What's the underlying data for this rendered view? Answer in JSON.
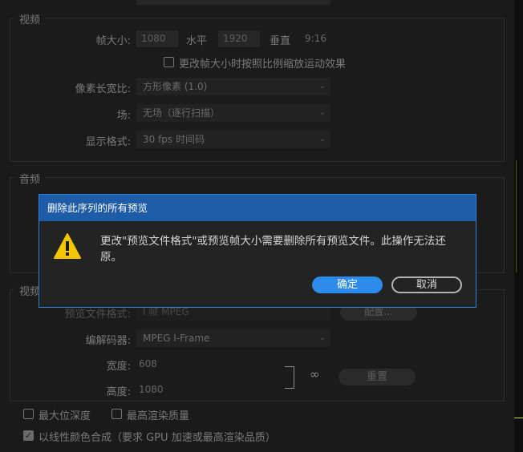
{
  "video": {
    "section_title": "视频",
    "frame_size_label": "帧大小:",
    "frame_size_value": "1080",
    "horizontal_label": "水平",
    "horizontal_value": "1920",
    "vertical_label": "垂直",
    "vertical_value": "9:16",
    "scale_checkbox_label": "更改帧大小时按照比例缩放运动效果",
    "pixel_aspect_label": "像素长宽比:",
    "pixel_aspect_value": "方形像素 (1.0)",
    "fields_label": "场:",
    "fields_value": "无场（逐行扫描）",
    "display_format_label": "显示格式:",
    "display_format_value": "30 fps 时间码"
  },
  "audio": {
    "section_title": "音频"
  },
  "preview": {
    "section_title": "视频",
    "format_label": "预览文件格式:",
    "format_value": "I 帧 MPEG",
    "configure_label": "配置...",
    "codec_label": "编解码器:",
    "codec_value": "MPEG I-Frame",
    "width_label": "宽度:",
    "width_value": "608",
    "height_label": "高度:",
    "height_value": "1080",
    "reset_label": "重置"
  },
  "options": {
    "max_bit_depth": "最大位深度",
    "max_render_quality": "最高渲染质量",
    "linear_color": "以线性颜色合成（要求 GPU 加速或最高渲染品质）"
  },
  "dialog": {
    "title": "删除此序列的所有预览",
    "message": "更改\"预览文件格式\"或预览帧大小需要删除所有预览文件。此操作无法还原。",
    "ok_label": "确定",
    "cancel_label": "取消",
    "icon": "warning-icon"
  },
  "colors": {
    "accent": "#2d8ceb",
    "title_bar": "#1e5ca8",
    "warning": "#f5c400",
    "preview_line": "#c8e600"
  }
}
